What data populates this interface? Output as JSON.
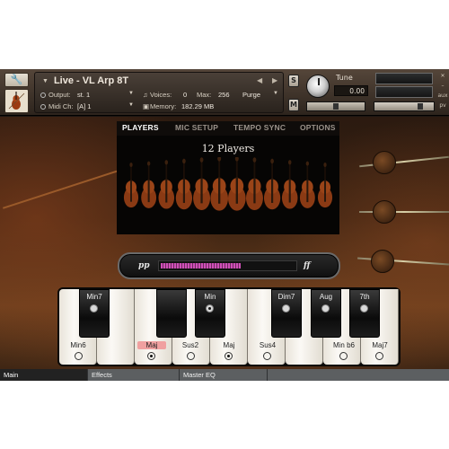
{
  "header": {
    "title": "Live - VL Arp 8T",
    "output_label": "Output:",
    "output_value": "st. 1",
    "voices_label": "Voices:",
    "voices_value": "0",
    "max_label": "Max:",
    "max_value": "256",
    "purge_label": "Purge",
    "midi_label": "Midi Ch:",
    "midi_value": "[A]  1",
    "memory_label": "Memory:",
    "memory_value": "182.29 MB",
    "solo_label": "S",
    "mute_label": "M",
    "tune_label": "Tune",
    "tune_value": "0.00",
    "aux_label": "aux",
    "pv_label": "pv"
  },
  "tabs": [
    "PLAYERS",
    "MIC SETUP",
    "TEMPO SYNC",
    "OPTIONS"
  ],
  "active_tab": "PLAYERS",
  "players": {
    "title": "12 Players",
    "count": 12
  },
  "velocity": {
    "low_label": "pp",
    "high_label": "ff",
    "level": 0.6
  },
  "keyboard": {
    "black_keys": [
      {
        "label": "Min7",
        "selected": false
      },
      {
        "label": "",
        "selected": false
      },
      {
        "label": "Min",
        "selected": true
      },
      {
        "label": "Dim7",
        "selected": false
      },
      {
        "label": "Aug",
        "selected": false
      },
      {
        "label": "7th",
        "selected": false
      }
    ],
    "white_keys": [
      {
        "label": "Min6",
        "selected": false
      },
      {
        "label": "Maj",
        "selected": true
      },
      {
        "label": "Sus2",
        "selected": false
      },
      {
        "label": "Maj",
        "selected": true
      },
      {
        "label": "Sus4",
        "selected": false
      },
      {
        "label": "Min b6",
        "selected": false
      },
      {
        "label": "Maj7",
        "selected": false
      }
    ]
  },
  "bottom_tabs": [
    "Main",
    "Effects",
    "Master EQ"
  ],
  "active_bottom_tab": "Main"
}
